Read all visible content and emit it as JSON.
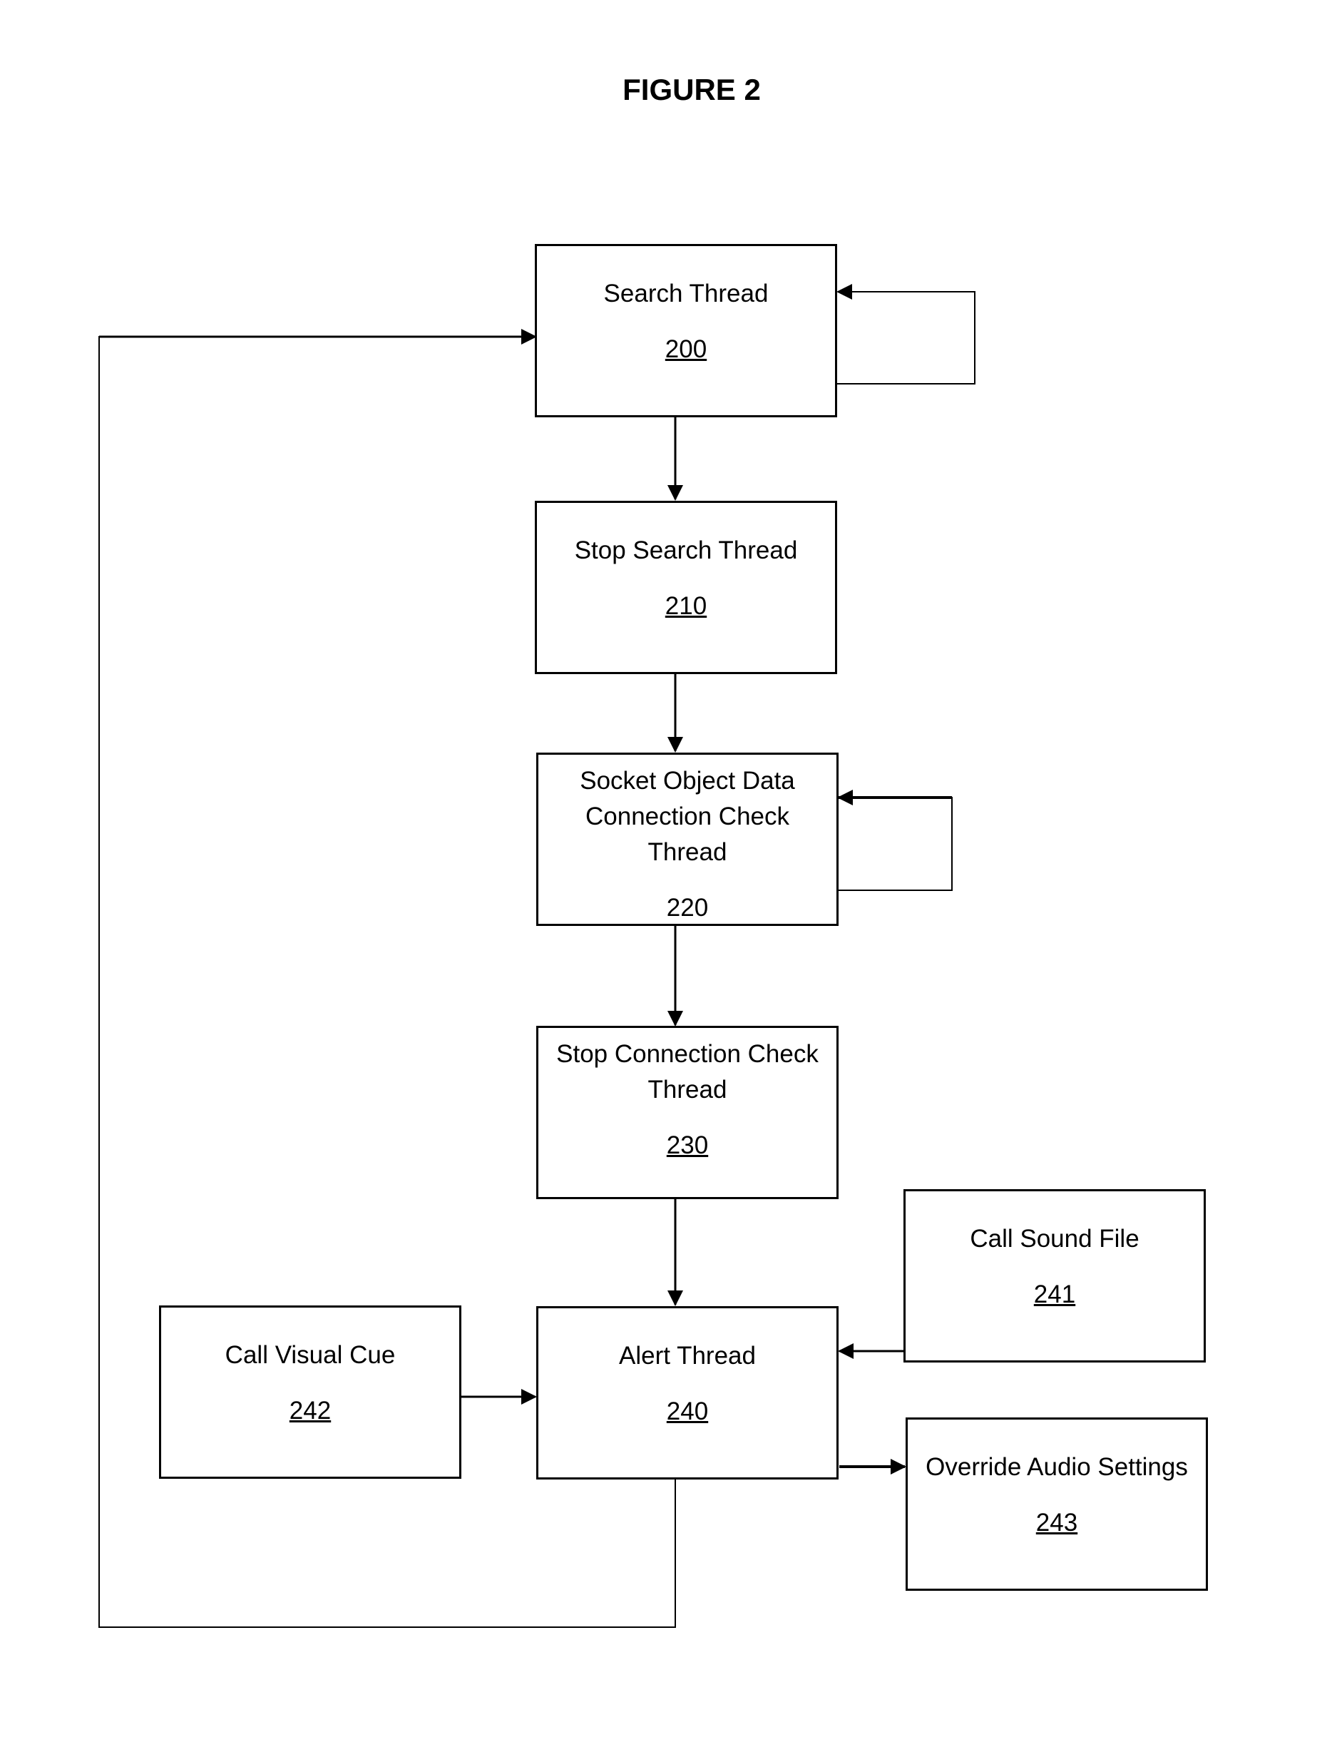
{
  "title": "FIGURE 2",
  "nodes": [
    {
      "id": "200",
      "label": "Search Thread",
      "number": "200",
      "underlined": true
    },
    {
      "id": "210",
      "label": "Stop Search Thread",
      "number": "210",
      "underlined": true
    },
    {
      "id": "220",
      "label_lines": [
        "Socket Object Data",
        "Connection Check",
        "Thread"
      ],
      "number": "220",
      "underlined": false
    },
    {
      "id": "230",
      "label_lines": [
        "Stop Connection Check",
        "Thread"
      ],
      "number": "230",
      "underlined": true
    },
    {
      "id": "240",
      "label": "Alert Thread",
      "number": "240",
      "underlined": true
    },
    {
      "id": "241",
      "label": "Call Sound File",
      "number": "241",
      "underlined": true
    },
    {
      "id": "242",
      "label": "Call Visual Cue",
      "number": "242",
      "underlined": true
    },
    {
      "id": "243",
      "label": "Override Audio Settings",
      "number": "243",
      "underlined": true
    }
  ],
  "edges": [
    {
      "from": "200",
      "to": "200",
      "type": "self-loop"
    },
    {
      "from": "200",
      "to": "210"
    },
    {
      "from": "210",
      "to": "220"
    },
    {
      "from": "220",
      "to": "220",
      "type": "self-loop"
    },
    {
      "from": "220",
      "to": "230"
    },
    {
      "from": "230",
      "to": "240"
    },
    {
      "from": "241",
      "to": "240"
    },
    {
      "from": "242",
      "to": "240"
    },
    {
      "from": "240",
      "to": "243"
    },
    {
      "from": "240",
      "to": "200",
      "type": "feedback"
    }
  ]
}
